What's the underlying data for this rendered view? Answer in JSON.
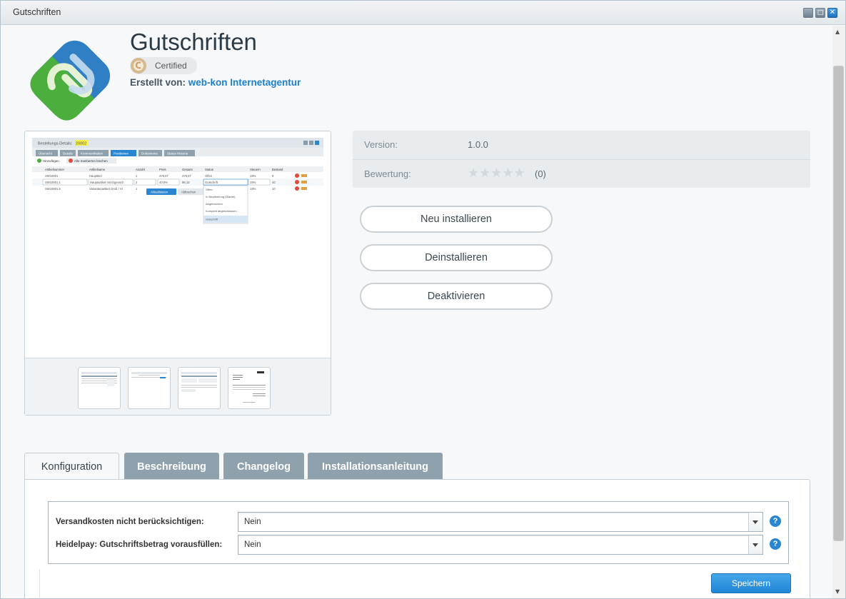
{
  "window": {
    "title": "Gutschriften"
  },
  "app": {
    "name": "Gutschriften",
    "certified_label": "Certified",
    "author_prefix": "Erstellt von:",
    "author_name": "web-kon Internetagentur"
  },
  "screenshot": {
    "window_title": "Bestellungs-Details:",
    "order_no": "20002",
    "tabs": [
      "Übersicht",
      "Details",
      "Kommunikation",
      "Positionen",
      "Dokumente",
      "Status Historie"
    ],
    "add_label": "Hinzufügen",
    "delete_label": "Alle markierten löschen",
    "columns": [
      "Artikelnummer",
      "Artikelname",
      "Anzahl",
      "Preis",
      "Gesamt",
      "Status",
      "Steuern",
      "Bestand"
    ],
    "rows": [
      [
        "SW10001",
        "Haupttitel",
        "1",
        "478,97",
        "478,97",
        "Offen",
        "19%",
        "9"
      ],
      [
        "SW10001.1",
        "Hauptartikel mit Eigensch",
        "2",
        "40,0%",
        "96,10",
        "Gutschrift",
        "19%",
        "40"
      ],
      [
        "SW10001.5",
        "Variantenartikel Groß / Xl",
        "1",
        "",
        "",
        "",
        "19%",
        "10"
      ]
    ],
    "status_options": [
      "Offen",
      "In Bearbeitung (Wartet)",
      "Abgebrochen",
      "Komplett abgeschlossen",
      "Gutschrift"
    ],
    "update_label": "Aktualisieren",
    "cancel_label": "Abbrechen"
  },
  "info": {
    "version_label": "Version:",
    "version_value": "1.0.0",
    "rating_label": "Bewertung:",
    "rating_stars": "★★★★★",
    "rating_count": "(0)"
  },
  "actions": {
    "reinstall": "Neu installieren",
    "uninstall": "Deinstallieren",
    "deactivate": "Deaktivieren"
  },
  "tabs": [
    "Konfiguration",
    "Beschreibung",
    "Changelog",
    "Installationsanleitung"
  ],
  "config": {
    "fields": [
      {
        "label": "Versandkosten nicht berücksichtigen:",
        "value": "Nein"
      },
      {
        "label": "Heidelpay: Gutschriftsbetrag vorausfüllen:",
        "value": "Nein"
      }
    ],
    "save_label": "Speichern",
    "help_glyph": "?"
  }
}
